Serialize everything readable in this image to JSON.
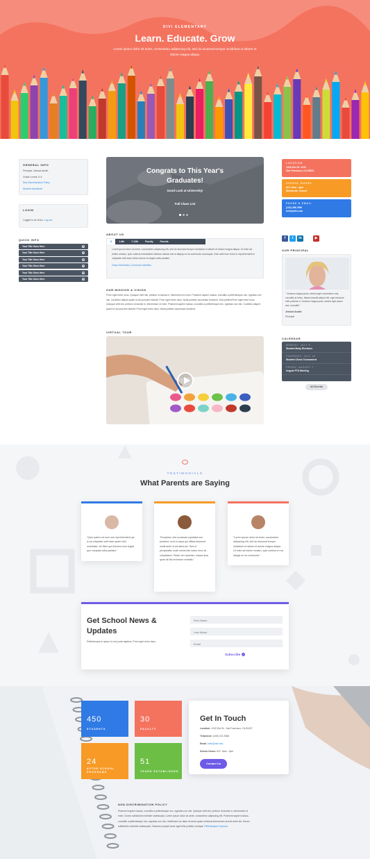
{
  "hero": {
    "kicker": "DIVI ELEMENTARY",
    "title": "Learn. Educate. Grow",
    "text": "Lorem ipsum dolor sit amet, consectetur adipiscing elit, sed do eiusmod tempor incididunt ut labore et dolore magna aliqua.",
    "colors": {
      "background": "#f4735f"
    }
  },
  "general_info": {
    "heading": "GENERAL INFO",
    "principal": "Principal: Jessica Austin",
    "grade": "Grade Levels: K-5",
    "link1": "Non-Discrimination Policy",
    "link2": "Student Handbook"
  },
  "login": {
    "heading": "LOGIN",
    "text": "Logged in as Victor.",
    "link": "Log out"
  },
  "quick_info": {
    "heading": "QUICK INFO",
    "items": [
      "Your Title Goes Here",
      "Your Title Goes Here",
      "Your Title Goes Here",
      "Your Title Goes Here",
      "Your Title Goes Here",
      "Your Title Goes Here"
    ]
  },
  "slider": {
    "title": "Congrats to This Year's Graduates!",
    "subtitle": "Good Luck at University!",
    "button": "Full Class List"
  },
  "about": {
    "heading": "ABOUT US",
    "tabs": [
      "K",
      "1-6th",
      "7-12th",
      "Faculty",
      "Parents"
    ],
    "text": "Lorem ipsum dolor sit amet, consectetur adipiscing elit, sed do eiusmod tempor incididunt ut labore et dolore magna aliqua. Ut enim ad minim veniam, quis nostrud exercitation ullamco laboris nisi ut aliquip ex ea commodo consequat. Duis aute irure dolor in reprehenderit in voluptate velit esse cillum dolore eu fugiat nulla pariatur.",
    "links": "Class Schedules | Curricular Activities"
  },
  "mission": {
    "heading": "OUR MISSION & VISION",
    "text": "Proin eget tortor risus. Quisque velit nisi, pretium ut lacinia in, elementum id enim. Praesent sapien massa, convallis a pellentesque nec, egestas non nisi. Curabitur aliquet quam id dui posuere blandit. Proin eget tortor risus. Nulla porttitor accumsan tincidunt. Sed porttitorProin eget tortor risus. Quisque velit nisi, pretium ut lacinia in, elementum id enim. Praesent sapien massa, convallis a pellentesque nec, egestas non nisi. Curabitur aliquet quam id dui posuere blandit. Proin eget tortor risus. Nulla porttitor accumsan tincidunt."
  },
  "tour": {
    "heading": "VIRTUAL TOUR"
  },
  "info_cards": [
    {
      "label": "LOCATION",
      "line1": "1234 Divi St. #100",
      "line2": "San Francisco, CA 93523",
      "color": "#f4735f"
    },
    {
      "label": "SCHOOL HOURS",
      "line1": "M-F: 8am - 4pm",
      "line2": "Weekends: Closed",
      "color": "#f79a26"
    },
    {
      "label": "PHONE & EMAIL",
      "line1": "(123) 456-7890",
      "line2": "hello@divi.edu",
      "color": "#2f7ae5"
    }
  ],
  "social": [
    {
      "icon": "facebook-icon",
      "glyph": "f",
      "color": "#3b5998"
    },
    {
      "icon": "twitter-icon",
      "glyph": "t",
      "color": "#1da1f2"
    },
    {
      "icon": "linkedin-icon",
      "glyph": "in",
      "color": "#0e76a8"
    },
    {
      "icon": "youtube-icon",
      "glyph": "▶",
      "color": "#c4302b"
    }
  ],
  "principal": {
    "heading": "OUR PRINCIPAL",
    "quote": "\" Vivamus magna justo, lacinia eget consectetur sed, convallis at tellus. Mauris blandit aliquet elit, eget tincidunt nibh pulvinar a. Vivamus magna justo, lacinia eget ipsum sed, convallis\"",
    "name": "Jessica Austin",
    "role": "Principal"
  },
  "calendar": {
    "heading": "CALENDAR",
    "events": [
      {
        "date": "MONDAY, JULY 9",
        "title": "Student Body Elections"
      },
      {
        "date": "THURSDAY, JULY 16",
        "title": "Student Chess Tournament"
      },
      {
        "date": "FRIDAY, AUGUST 7",
        "title": "August PTA Meeting"
      }
    ],
    "button": "All Events"
  },
  "testimonials": {
    "kicker": "TESTIMONIALS",
    "title": "What Parents are Saying",
    "items": [
      {
        "text": "\"Quis autem vel eum iure reprehenderit qui in ea voluptate velit esse quam nihil molestiae, vel illum qui dolorem eum fugiat quo voluptas nulla pariatur.\"",
        "color": "#2f7ae5"
      },
      {
        "text": "\"Excepteur sint occaecat cupidatat non proident, sunt in culpa qui officia deserunt mollit anim id est laborum. Sed ut perspiciatis unde omnis iste natus error sit voluptatem. Totam rem aperiam, eaque ipsa quae ab illo inventore veritatis.\"",
        "color": "#f79a26"
      },
      {
        "text": "\"Lorem ipsum dolor sit amet, consectetur adipiscing elit, sed do eiusmod tempor incididunt ut labore et dolore magna aliqua. Ut enim ad minim veniam, quis nostrud ex ea aliquip ex ea commodo.\"",
        "color": "#f4735f"
      }
    ]
  },
  "newsletter": {
    "title": "Get School News & Updates",
    "text": "Pellentesque in ipsum id orci porta dapibus. Proin eget tortor risus.",
    "first_name": "First Name",
    "last_name": "Last Name",
    "email": "Email",
    "button": "Subscribe"
  },
  "stats": [
    {
      "number": "450",
      "label": "STUDENTS",
      "color": "#2f7ae5"
    },
    {
      "number": "30",
      "label": "FACULTY",
      "color": "#f4735f"
    },
    {
      "number": "24",
      "label": "AFTER SCHOOL PROGRAMS",
      "color": "#f79a26"
    },
    {
      "number": "51",
      "label": "YEARS ESTABLISHED",
      "color": "#6dbe45"
    }
  ],
  "contact": {
    "title": "Get In Touch",
    "location_label": "Location:",
    "location": "1243 Divi St., San Francisco, CA 92427",
    "phone_label": "Telephone:",
    "phone": "(435) 123-3366",
    "email_label": "Email:",
    "email": "hello@divi.edu",
    "hours_label": "School Hours:",
    "hours": "M-F: 8am - 3pm",
    "button": "Contact Us"
  },
  "policy": {
    "heading": "NON-DISCRIMINATION POLICY",
    "text": "Praesent sapien massa, convallis a pellentesque nec, egestas non nisi. Quisque velit nisi, pretium ut lacinia in, elementum id enim. Donec sollicitudin molestie malesuada. Lorem ipsum dolor sit amet, consectetur adipiscing elit. Praesent sapien massa, convallis a pellentesque nec, egestas non nisi. Vestibulum ac diam sit amet quam vehicula elementum sed sit amet dui. Donec sollicitudin molestie malesuada. Vivamus suscipit tortor eget felis porttitor volutpat.",
    "link": "Pellentesque in ipsum."
  }
}
